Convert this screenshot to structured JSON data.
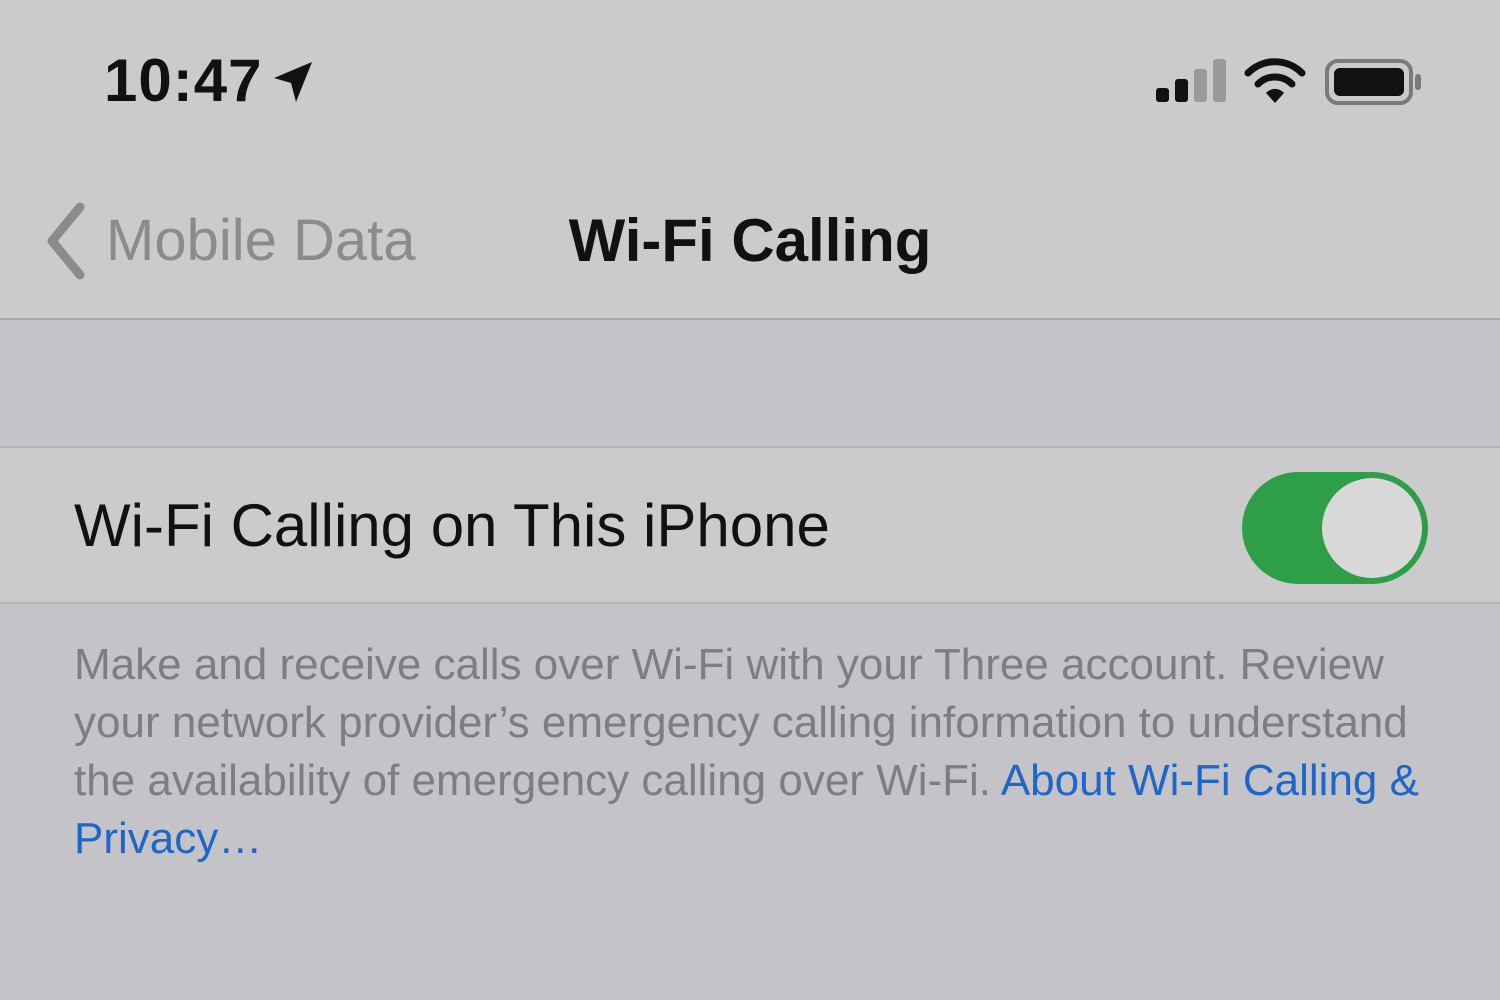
{
  "status_bar": {
    "time": "10:47",
    "icons": [
      "location-arrow-icon",
      "cellular-signal-icon",
      "wifi-icon",
      "battery-icon"
    ]
  },
  "nav": {
    "back_label": "Mobile Data",
    "title": "Wi-Fi Calling"
  },
  "settings": {
    "wifi_calling": {
      "label": "Wi-Fi Calling on This iPhone",
      "enabled": true
    }
  },
  "footer": {
    "description": "Make and receive calls over Wi-Fi with your Three account. Review your network provider’s emergency calling information to understand the availability of emergency calling over Wi-Fi. ",
    "link_text": "About Wi-Fi Calling & Privacy…"
  },
  "colors": {
    "background": "#c3c3c8",
    "bar_background": "#cbcbcb",
    "toggle_on": "#2e9e48",
    "link": "#1e67c8",
    "secondary_text": "#7d7d82"
  }
}
